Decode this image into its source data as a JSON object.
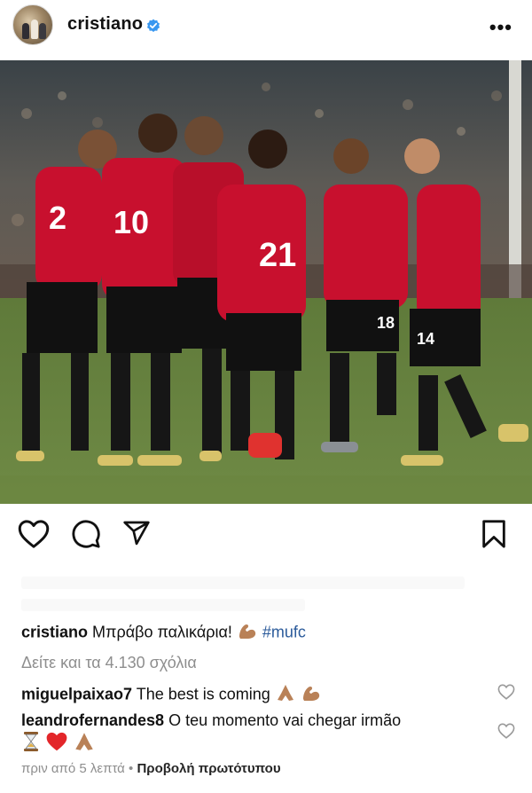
{
  "post": {
    "username": "cristiano",
    "more_label": "•••"
  },
  "caption": {
    "username": "cristiano",
    "text": "Μπράβο παλικάρια!",
    "hashtag": "#mufc"
  },
  "view_comments": "Δείτε και τα 4.130 σχόλια",
  "comments": [
    {
      "username": "miguelpaixao7",
      "text": "The best is coming"
    },
    {
      "username": "leandrofernandes8",
      "text": "O teu momento vai chegar irmão"
    }
  ],
  "footer": {
    "time": "πριν από 5 λεπτά",
    "separator": "•",
    "see_original": "Προβολή πρωτότυπου"
  },
  "icons": [
    "like-icon",
    "comment-icon",
    "share-icon",
    "save-icon",
    "verified-icon",
    "more-icon"
  ],
  "colors": {
    "hashtag": "#2a5a9a",
    "verified": "#3897f0",
    "muted": "#8e8e8e",
    "kit_red": "#c8102e"
  }
}
